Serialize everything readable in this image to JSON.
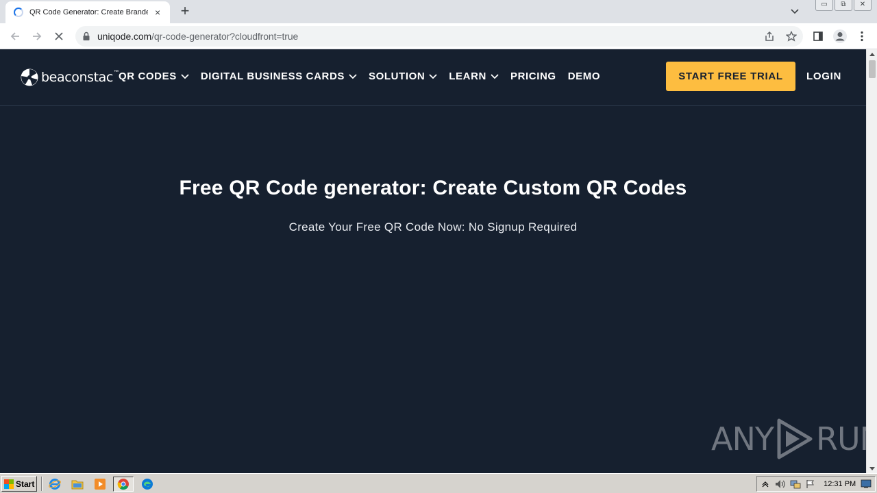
{
  "browser": {
    "tab": {
      "title": "QR Code Generator: Create Branded",
      "close_glyph": "×",
      "icon": "loading-spinner-icon"
    },
    "new_tab_glyph": "+",
    "window_controls": {
      "minimize": "▭",
      "restore": "⧉",
      "close": "✕"
    },
    "address": {
      "host": "uniqode.com",
      "path": "/qr-code-generator?cloudfront=true"
    },
    "colors": {
      "tabbar": "#dee1e6",
      "accent": "#1a73e8"
    }
  },
  "site": {
    "logo_text": "beaconstac",
    "logo_tm": "™",
    "nav": [
      {
        "label": "QR CODES",
        "has_dropdown": true
      },
      {
        "label": "DIGITAL BUSINESS CARDS",
        "has_dropdown": true
      },
      {
        "label": "SOLUTION",
        "has_dropdown": true
      },
      {
        "label": "LEARN",
        "has_dropdown": true
      },
      {
        "label": "PRICING",
        "has_dropdown": false
      },
      {
        "label": "DEMO",
        "has_dropdown": false
      }
    ],
    "cta_label": "START FREE TRIAL",
    "login_label": "LOGIN",
    "colors": {
      "background": "#16202f",
      "cta": "#fdbd40",
      "text": "#ffffff"
    }
  },
  "hero": {
    "title": "Free QR Code generator: Create Custom QR Codes",
    "subtitle": "Create Your Free QR Code Now: No Signup Required"
  },
  "watermark": {
    "left": "ANY",
    "right": "RUN"
  },
  "taskbar": {
    "start_label": "Start",
    "quick_launch": [
      "internet-explorer-icon",
      "folder-icon",
      "media-player-icon",
      "chrome-icon",
      "edge-icon"
    ],
    "clock": "12:31 PM"
  }
}
